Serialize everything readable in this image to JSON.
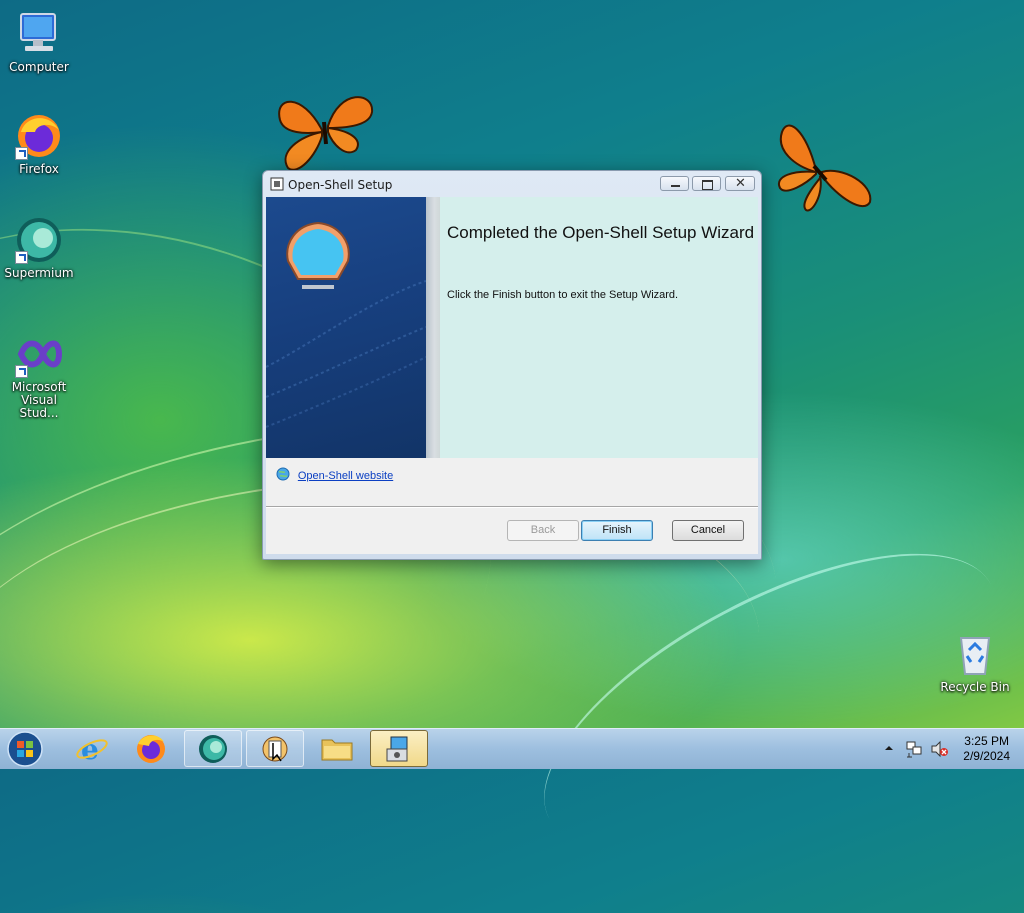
{
  "desktop": {
    "icons": [
      {
        "label": "Computer"
      },
      {
        "label": "Firefox"
      },
      {
        "label": "Supermium"
      },
      {
        "label": "Microsoft Visual Stud..."
      },
      {
        "label": "Recycle Bin"
      }
    ]
  },
  "window": {
    "title": "Open-Shell Setup",
    "heading": "Completed the Open-Shell Setup Wizard",
    "body_text": "Click the Finish button to exit the Setup Wizard.",
    "link_text": "Open-Shell website",
    "buttons": {
      "back": "Back",
      "finish": "Finish",
      "cancel": "Cancel"
    }
  },
  "taskbar": {
    "items": [
      "start",
      "internet-explorer",
      "firefox",
      "supermium",
      "open-shell-menu",
      "file-explorer",
      "setup-installer"
    ],
    "clock": {
      "time": "3:25 PM",
      "date": "2/9/2024"
    }
  },
  "colors": {
    "accent": "#1c4a8e",
    "content_bg": "#d5efec",
    "link": "#0b3fc2"
  }
}
